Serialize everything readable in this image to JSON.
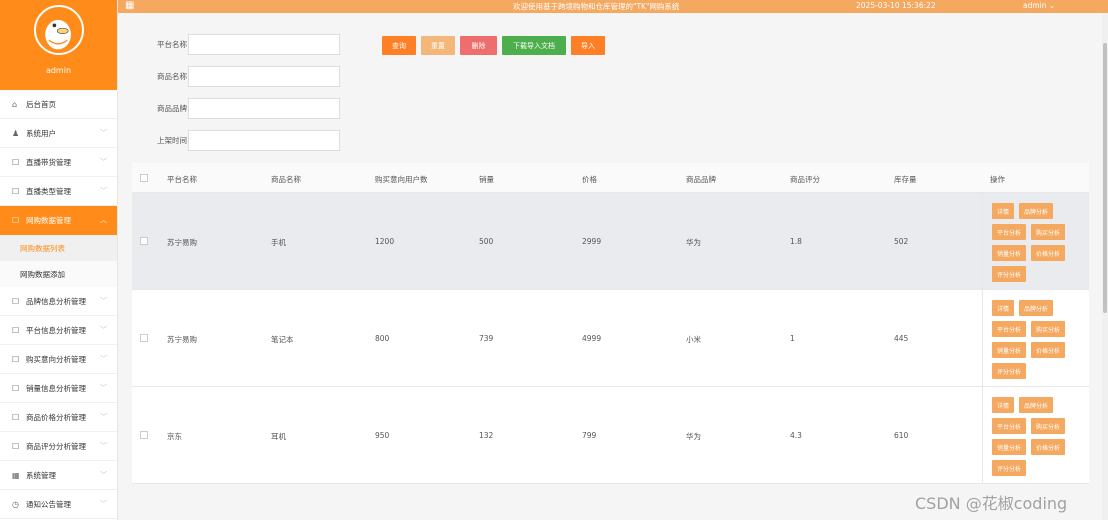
{
  "sidebar": {
    "username": "admin",
    "items": [
      {
        "label": "后台首页",
        "icon": "⌂",
        "chevron": false
      },
      {
        "label": "系统用户",
        "icon": "♟",
        "chevron": true
      },
      {
        "label": "直播带货管理",
        "icon": "☐",
        "chevron": true
      },
      {
        "label": "直播类型管理",
        "icon": "☐",
        "chevron": true
      },
      {
        "label": "网购数据管理",
        "icon": "☐",
        "chevron": true,
        "active": true,
        "sub": [
          {
            "label": "网购数据列表",
            "current": true
          },
          {
            "label": "网购数据添加"
          }
        ]
      },
      {
        "label": "品牌信息分析管理",
        "icon": "☐",
        "chevron": true
      },
      {
        "label": "平台信息分析管理",
        "icon": "☐",
        "chevron": true
      },
      {
        "label": "购买意向分析管理",
        "icon": "☐",
        "chevron": true
      },
      {
        "label": "销量信息分析管理",
        "icon": "☐",
        "chevron": true
      },
      {
        "label": "商品价格分析管理",
        "icon": "☐",
        "chevron": true
      },
      {
        "label": "商品评分分析管理",
        "icon": "☐",
        "chevron": true
      },
      {
        "label": "系统管理",
        "icon": "▦",
        "chevron": true
      },
      {
        "label": "通知公告管理",
        "icon": "◷",
        "chevron": true
      }
    ]
  },
  "topbar": {
    "welcome": "欢迎使用基于跨境购物和仓库管理的\"TK\"网购系统",
    "time": "2025-03-10 15:36:22",
    "user": "admin ⌄"
  },
  "search": {
    "fields": [
      {
        "label": "平台名称",
        "value": ""
      },
      {
        "label": "商品名称",
        "value": ""
      },
      {
        "label": "商品品牌",
        "value": ""
      },
      {
        "label": "上架时间",
        "value": ""
      }
    ],
    "buttons": [
      {
        "label": "查询",
        "color": "#ff7f27"
      },
      {
        "label": "重置",
        "color": "#f4b77a"
      },
      {
        "label": "删除",
        "color": "#ee6e6e"
      },
      {
        "label": "下载导入文档",
        "color": "#4cae4c"
      },
      {
        "label": "导入",
        "color": "#ff7f27"
      }
    ]
  },
  "table": {
    "headers": [
      "平台名称",
      "商品名称",
      "购买意向用户数",
      "销量",
      "价格",
      "商品品牌",
      "商品评分",
      "库存量",
      "操作"
    ],
    "rows": [
      [
        "苏宁易购",
        "手机",
        "1200",
        "500",
        "2999",
        "华为",
        "1.8",
        "502"
      ],
      [
        "苏宁易购",
        "笔记本",
        "800",
        "739",
        "4999",
        "小米",
        "1",
        "445"
      ],
      [
        "京东",
        "耳机",
        "950",
        "132",
        "799",
        "华为",
        "4.3",
        "610"
      ]
    ],
    "row_actions": [
      "详情",
      "品牌分析",
      "平台分析",
      "购买分析",
      "销量分析",
      "价格分析",
      "评分分析"
    ]
  },
  "watermark": "CSDN @花椒coding"
}
